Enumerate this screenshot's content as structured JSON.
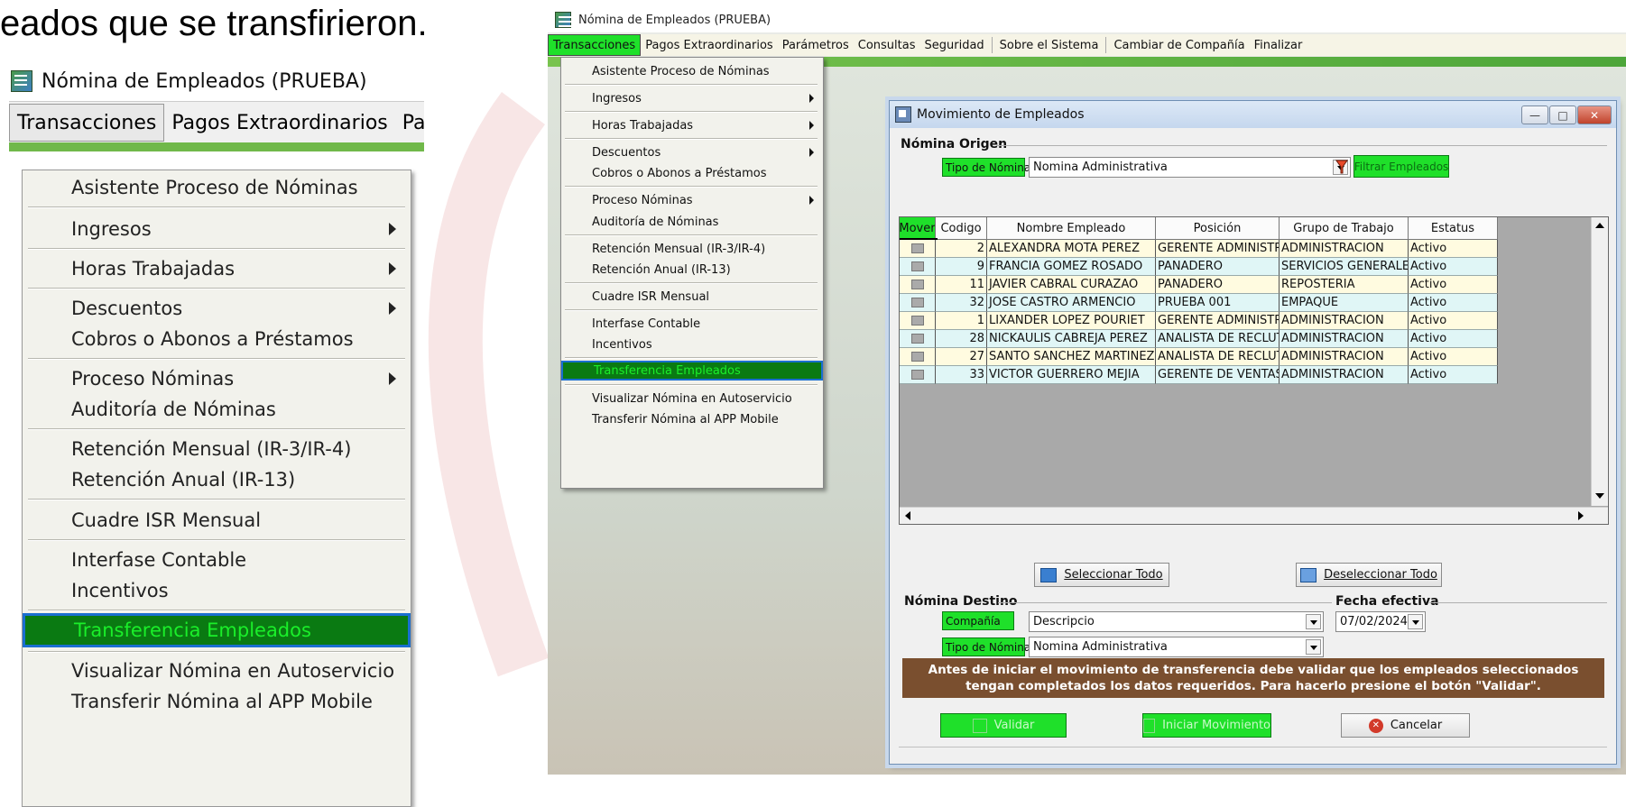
{
  "slide": {
    "heading": "eados que se transfirieron."
  },
  "app": {
    "window_title": "Nómina de Empleados (PRUEBA)",
    "menubar_zoom": [
      "Transacciones",
      "Pagos Extraordinarios",
      "Parár"
    ],
    "menubar": [
      "Transacciones",
      "Pagos Extraordinarios",
      "Parámetros",
      "Consultas",
      "Seguridad",
      "Sobre el Sistema",
      "Cambiar de Compañía",
      "Finalizar"
    ],
    "active_menu": "Transacciones"
  },
  "menu": {
    "items": [
      {
        "label": "Asistente Proceso de Nóminas"
      },
      {
        "label": "Ingresos",
        "submenu": true
      },
      {
        "label": "Horas Trabajadas",
        "submenu": true
      },
      {
        "label": "Descuentos",
        "submenu": true
      },
      {
        "label": "Cobros o Abonos a Préstamos"
      },
      {
        "label": "Proceso Nóminas",
        "submenu": true
      },
      {
        "label": "Auditoría de Nóminas"
      },
      {
        "label": "Retención Mensual  (IR-3/IR-4)"
      },
      {
        "label": "Retención Anual  (IR-13)"
      },
      {
        "label": "Cuadre ISR Mensual"
      },
      {
        "label": "Interfase Contable"
      },
      {
        "label": "Incentivos"
      },
      {
        "label": "Transferencia Empleados",
        "highlighted": true
      },
      {
        "label": "Visualizar Nómina en Autoservicio"
      },
      {
        "label": "Transferir Nómina al APP Mobile"
      }
    ]
  },
  "dialog": {
    "title": "Movimiento de Empleados",
    "origin_group": "Nómina Origen",
    "tipo_nomina_label": "Tipo de Nómina",
    "tipo_nomina_value": "Nomina Administrativa",
    "filter_button": "Filtrar Empleados",
    "table": {
      "columns": [
        "Mover",
        "Codigo",
        "Nombre Empleado",
        "Posición",
        "Grupo de Trabajo",
        "Estatus"
      ],
      "rows": [
        {
          "codigo": "2",
          "nombre": "ALEXANDRA MOTA PEREZ",
          "posicion": "GERENTE ADMINISTRA",
          "grupo": "ADMINISTRACION",
          "estatus": "Activo"
        },
        {
          "codigo": "9",
          "nombre": "FRANCIA GOMEZ ROSADO",
          "posicion": "PANADERO",
          "grupo": "SERVICIOS GENERALES",
          "estatus": "Activo"
        },
        {
          "codigo": "11",
          "nombre": "JAVIER CABRAL CURAZAO",
          "posicion": "PANADERO",
          "grupo": "REPOSTERIA",
          "estatus": "Activo"
        },
        {
          "codigo": "32",
          "nombre": "JOSE CASTRO ARMENCIO",
          "posicion": "PRUEBA 001",
          "grupo": "EMPAQUE",
          "estatus": "Activo"
        },
        {
          "codigo": "1",
          "nombre": "LIXANDER LOPEZ POURIET",
          "posicion": "GERENTE ADMINISTRA",
          "grupo": "ADMINISTRACION",
          "estatus": "Activo"
        },
        {
          "codigo": "28",
          "nombre": "NICKAULIS CABREJA PEREZ",
          "posicion": "ANALISTA DE RECLUTA",
          "grupo": "ADMINISTRACION",
          "estatus": "Activo"
        },
        {
          "codigo": "27",
          "nombre": "SANTO SANCHEZ MARTINEZ",
          "posicion": "ANALISTA DE RECLUTA",
          "grupo": "ADMINISTRACION",
          "estatus": "Activo"
        },
        {
          "codigo": "33",
          "nombre": "VICTOR GUERRERO MEJIA",
          "posicion": "GERENTE DE VENTAS",
          "grupo": "ADMINISTRACION",
          "estatus": "Activo"
        }
      ]
    },
    "select_all": "Seleccionar Todo",
    "deselect_all": "Deseleccionar Todo",
    "dest_group": "Nómina Destino",
    "fecha_label": "Fecha efectiva",
    "fecha_value": "07/02/2024",
    "compania_label": "Compañía",
    "compania_value": "Descripcio",
    "tipo_nomina_dest_label": "Tipo de Nómina",
    "tipo_nomina_dest_value": "Nomina Administrativa",
    "info_text": "Antes de iniciar el movimiento de transferencia debe validar que los empleados seleccionados tengan completados los datos requeridos. Para hacerlo presione el botón \"Validar\".",
    "validar": "Validar",
    "iniciar": "Iniciar Movimiento",
    "cancelar": "Cancelar"
  },
  "colors": {
    "highlight_green": "#1fe02a",
    "menu_selected_bg": "#0a7a12",
    "menu_selected_border": "#1a6fd0",
    "banner_brown": "#7a4f2f"
  }
}
